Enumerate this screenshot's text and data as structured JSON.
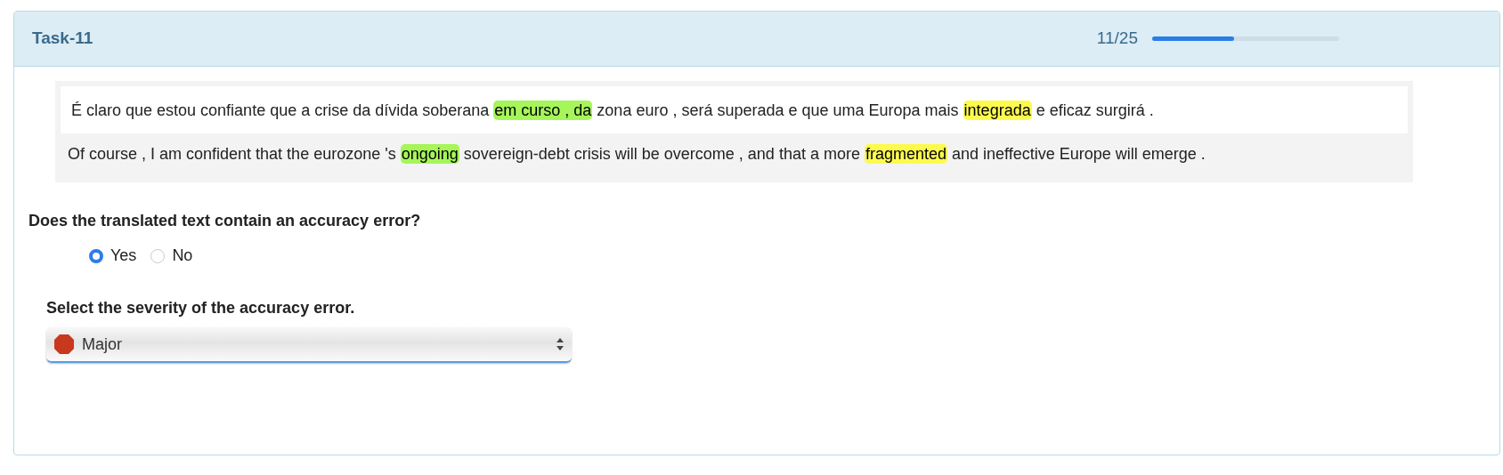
{
  "header": {
    "title": "Task-11",
    "progress_text": "11/25",
    "progress": {
      "level": 0.44
    }
  },
  "source": {
    "segments": [
      {
        "text": "É claro que estou confiante que a crise da dívida soberana "
      },
      {
        "text": "em curso , da",
        "color": "#a6f55a"
      },
      {
        "text": " zona euro , será superada e que uma Europa mais "
      },
      {
        "text": "integrada",
        "color": "#fdfa4f"
      },
      {
        "text": " e eficaz surgirá ."
      }
    ]
  },
  "translation": {
    "segments": [
      {
        "text": "Of course , I am confident that the eurozone 's "
      },
      {
        "text": "ongoing",
        "color": "#a6f55a"
      },
      {
        "text": " sovereign-debt crisis will be overcome , and that a more "
      },
      {
        "text": "fragmented",
        "color": "#fdfa4f"
      },
      {
        "text": " and ineffective Europe will emerge ."
      }
    ]
  },
  "question": {
    "text": "Does the translated text contain an accuracy error?",
    "options": [
      {
        "label": "Yes",
        "selected": true
      },
      {
        "label": "No",
        "selected": false
      }
    ]
  },
  "severity": {
    "label": "Select the severity of the accuracy error.",
    "value": "Major"
  }
}
